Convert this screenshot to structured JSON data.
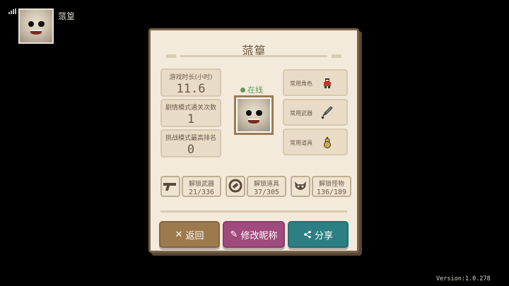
{
  "hud": {
    "player_name": "蒎篁",
    "signal_icon": "signal-bars-icon"
  },
  "panel": {
    "title": "蒎篁",
    "stats": [
      {
        "label": "游戏时长(小时)",
        "value": "11.6"
      },
      {
        "label": "剧情模式通关次数",
        "value": "1"
      },
      {
        "label": "挑战模式最高排名",
        "value": "0"
      }
    ],
    "status": "在线",
    "favorites": [
      {
        "label": "常用角色",
        "icon": "character-icon"
      },
      {
        "label": "常用武器",
        "icon": "sword-icon"
      },
      {
        "label": "常用道具",
        "icon": "gourd-icon"
      }
    ],
    "unlocks": [
      {
        "label": "解锁武器",
        "count": "21/336",
        "icon": "gun-icon"
      },
      {
        "label": "解锁道具",
        "count": "37/305",
        "icon": "item-icon"
      },
      {
        "label": "解锁怪物",
        "count": "136/189",
        "icon": "monster-icon"
      }
    ],
    "buttons": {
      "back": "返回",
      "edit": "修改昵称",
      "share": "分享"
    }
  },
  "version": "Version:1.0.278",
  "colors": {
    "online": "#5d9a5a",
    "back": "#9d7a4e",
    "edit": "#a04b7d",
    "share": "#2e7f84"
  }
}
